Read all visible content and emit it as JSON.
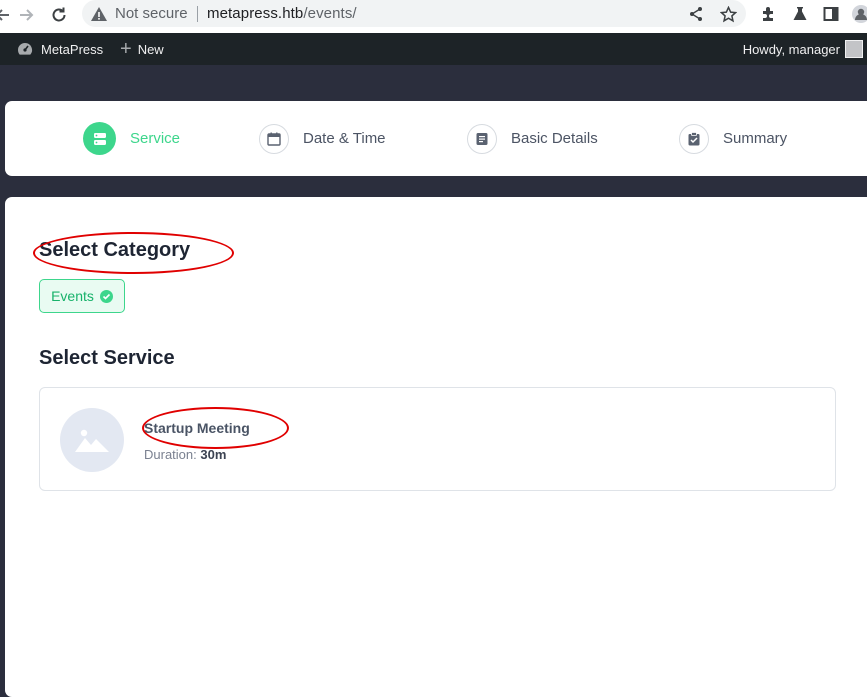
{
  "browser": {
    "security_label": "Not secure",
    "url_host": "metapress.htb",
    "url_path": "/events/"
  },
  "adminbar": {
    "site_name": "MetaPress",
    "new_label": "New",
    "greeting": "Howdy, manager"
  },
  "steps": [
    {
      "label": "Service",
      "icon": "server-icon",
      "active": true
    },
    {
      "label": "Date & Time",
      "icon": "calendar-icon",
      "active": false
    },
    {
      "label": "Basic Details",
      "icon": "document-icon",
      "active": false
    },
    {
      "label": "Summary",
      "icon": "clipboard-check-icon",
      "active": false
    }
  ],
  "category": {
    "heading": "Select Category",
    "chip_label": "Events"
  },
  "service": {
    "heading": "Select Service",
    "name": "Startup Meeting",
    "duration_label": "Duration:",
    "duration_value": "30m"
  },
  "colors": {
    "accent": "#3dd68c",
    "annotation": "#e00000",
    "adminbar_bg": "#1d2327",
    "page_bg": "#2b2e3d"
  }
}
